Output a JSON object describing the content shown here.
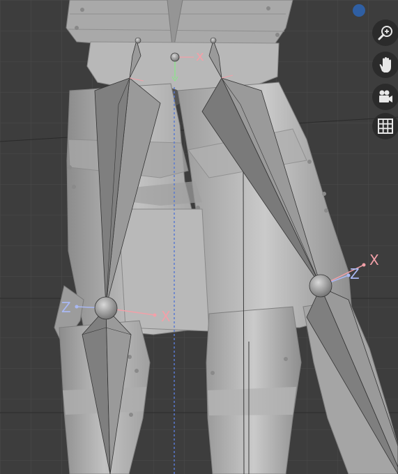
{
  "viewport": {
    "axis_labels": {
      "left_knee_z": "Z",
      "left_knee_x": "X",
      "right_knee_z": "Z",
      "right_knee_x": "X",
      "pelvis_x": "x"
    },
    "colors": {
      "background": "#3d3d3d",
      "grid": "#4a4a4a",
      "mesh_light": "#b3b3b3",
      "mesh_mid": "#9a9a9a",
      "mesh_dark": "#7c7c7c",
      "bone": "#8a8a8a",
      "bone_dark": "#6e6e6e",
      "x_axis": "#f2a0a8",
      "z_axis": "#a9b8f2",
      "y_axis": "#8fe08f",
      "gizmo_dot": "#2f5fa3"
    }
  },
  "nav_controls": [
    {
      "name": "zoom-button",
      "icon": "magnifier-plus-icon"
    },
    {
      "name": "pan-button",
      "icon": "hand-icon"
    },
    {
      "name": "camera-button",
      "icon": "camera-icon"
    },
    {
      "name": "grid-button",
      "icon": "grid-icon"
    }
  ]
}
